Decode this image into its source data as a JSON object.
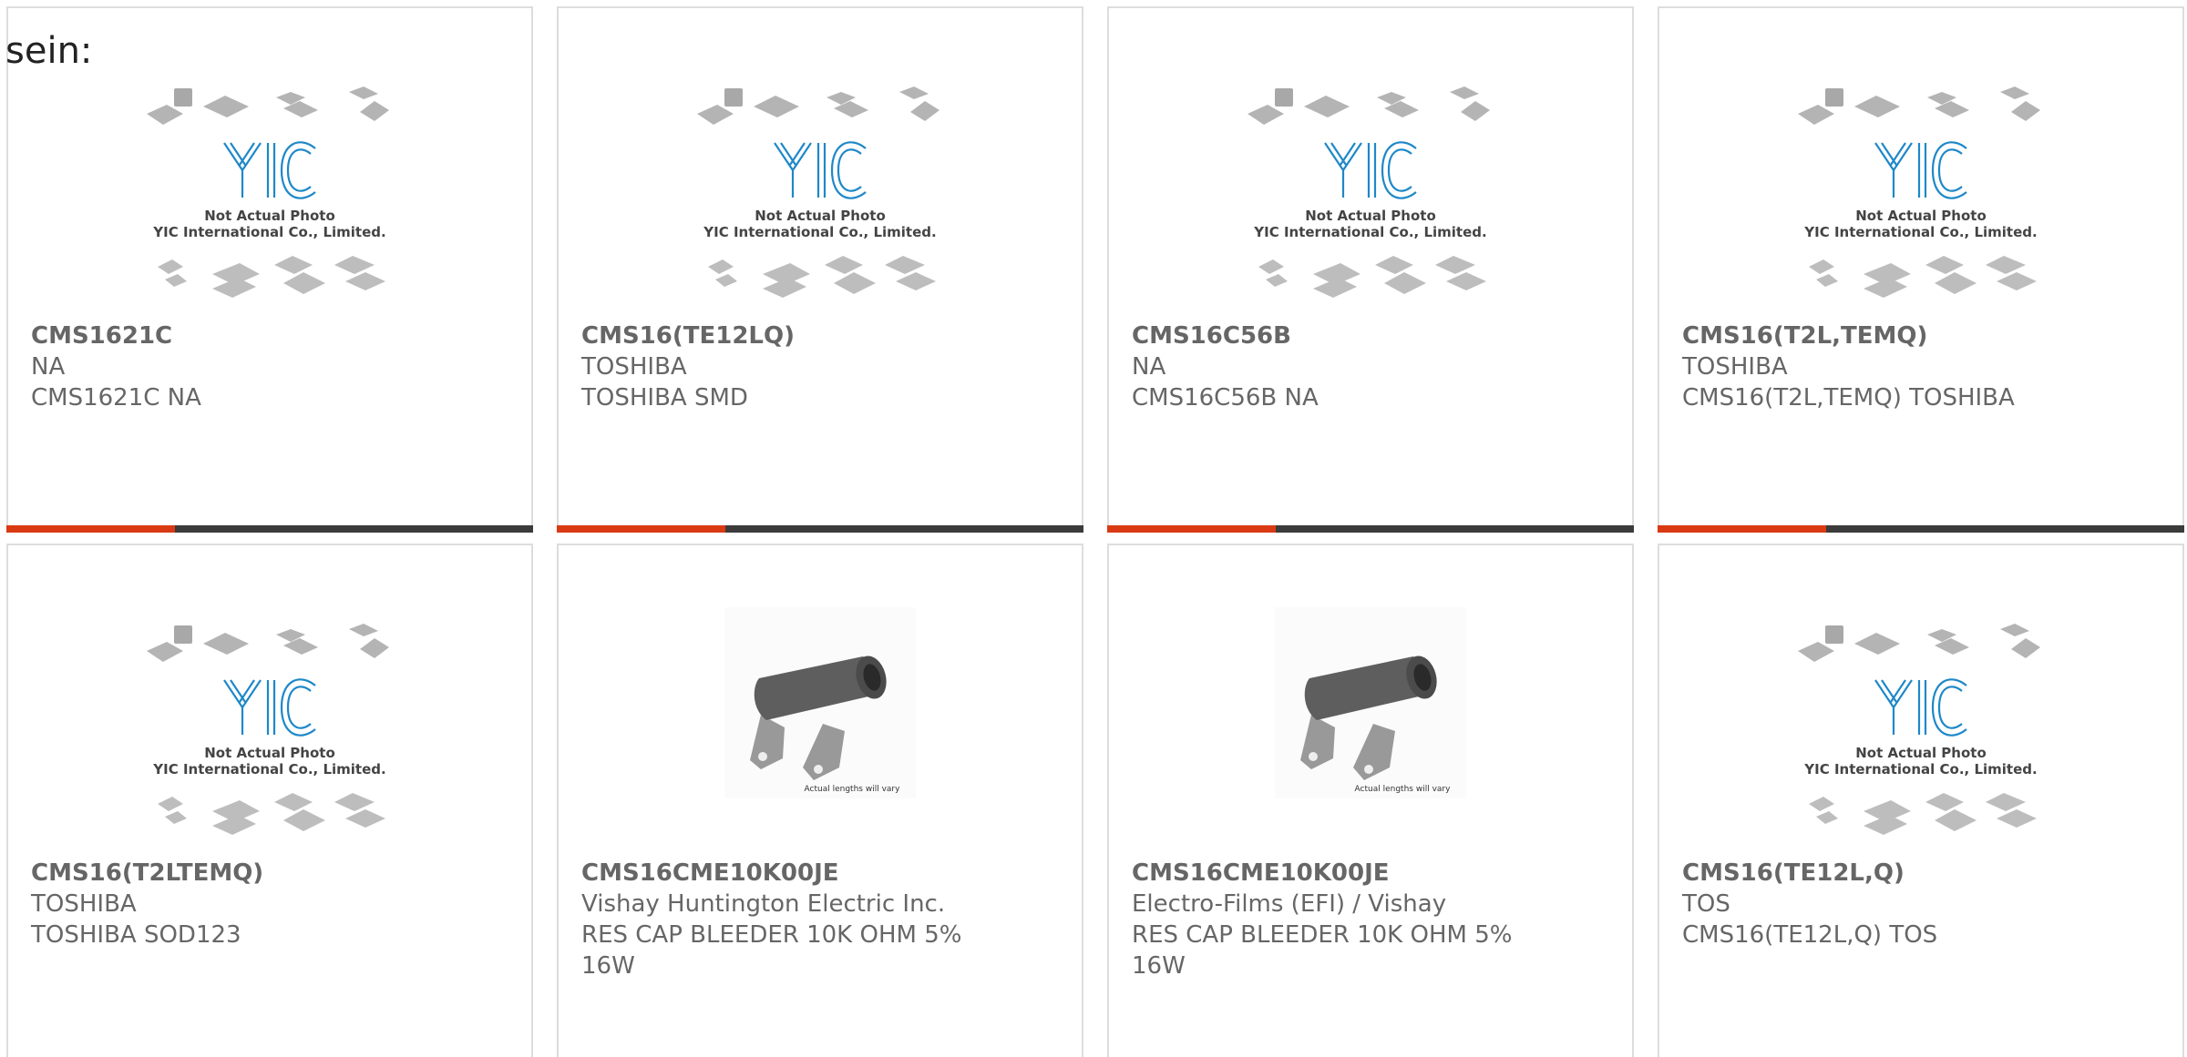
{
  "lead_text": "sein:",
  "placeholder_image": {
    "line1": "Not Actual Photo",
    "line2": "YIC International Co., Limited."
  },
  "resistor_image": {
    "caption": "Actual lengths will vary"
  },
  "colors": {
    "accent": "#d93a14",
    "bar_dark": "#3b3b3b",
    "text": "#666666",
    "logo_blue": "#1e88c8"
  },
  "products": [
    {
      "part_number": "CMS1621C",
      "manufacturer": "NA",
      "description": "CMS1621C NA",
      "image": "yic-placeholder"
    },
    {
      "part_number": "CMS16(TE12LQ)",
      "manufacturer": "TOSHIBA",
      "description": "TOSHIBA SMD",
      "image": "yic-placeholder"
    },
    {
      "part_number": "CMS16C56B",
      "manufacturer": "NA",
      "description": "CMS16C56B NA",
      "image": "yic-placeholder"
    },
    {
      "part_number": "CMS16(T2L,TEMQ)",
      "manufacturer": "TOSHIBA",
      "description": "CMS16(T2L,TEMQ) TOSHIBA",
      "image": "yic-placeholder"
    },
    {
      "part_number": "CMS16(T2LTEMQ)",
      "manufacturer": "TOSHIBA",
      "description": "TOSHIBA SOD123",
      "image": "yic-placeholder"
    },
    {
      "part_number": "CMS16CME10K00JE",
      "manufacturer": "Vishay Huntington Electric Inc.",
      "description": "RES CAP BLEEDER 10K OHM 5% 16W",
      "image": "resistor-photo"
    },
    {
      "part_number": "CMS16CME10K00JE",
      "manufacturer": "Electro-Films (EFI) / Vishay",
      "description": "RES CAP BLEEDER 10K OHM 5% 16W",
      "image": "resistor-photo"
    },
    {
      "part_number": "CMS16(TE12L,Q)",
      "manufacturer": "TOS",
      "description": "CMS16(TE12L,Q) TOS",
      "image": "yic-placeholder"
    }
  ]
}
